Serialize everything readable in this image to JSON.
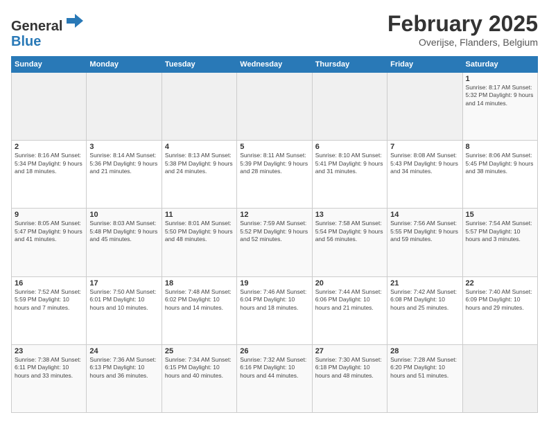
{
  "header": {
    "logo_general": "General",
    "logo_blue": "Blue",
    "month": "February 2025",
    "location": "Overijse, Flanders, Belgium"
  },
  "days_of_week": [
    "Sunday",
    "Monday",
    "Tuesday",
    "Wednesday",
    "Thursday",
    "Friday",
    "Saturday"
  ],
  "weeks": [
    [
      {
        "day": "",
        "info": ""
      },
      {
        "day": "",
        "info": ""
      },
      {
        "day": "",
        "info": ""
      },
      {
        "day": "",
        "info": ""
      },
      {
        "day": "",
        "info": ""
      },
      {
        "day": "",
        "info": ""
      },
      {
        "day": "1",
        "info": "Sunrise: 8:17 AM\nSunset: 5:32 PM\nDaylight: 9 hours and 14 minutes."
      }
    ],
    [
      {
        "day": "2",
        "info": "Sunrise: 8:16 AM\nSunset: 5:34 PM\nDaylight: 9 hours and 18 minutes."
      },
      {
        "day": "3",
        "info": "Sunrise: 8:14 AM\nSunset: 5:36 PM\nDaylight: 9 hours and 21 minutes."
      },
      {
        "day": "4",
        "info": "Sunrise: 8:13 AM\nSunset: 5:38 PM\nDaylight: 9 hours and 24 minutes."
      },
      {
        "day": "5",
        "info": "Sunrise: 8:11 AM\nSunset: 5:39 PM\nDaylight: 9 hours and 28 minutes."
      },
      {
        "day": "6",
        "info": "Sunrise: 8:10 AM\nSunset: 5:41 PM\nDaylight: 9 hours and 31 minutes."
      },
      {
        "day": "7",
        "info": "Sunrise: 8:08 AM\nSunset: 5:43 PM\nDaylight: 9 hours and 34 minutes."
      },
      {
        "day": "8",
        "info": "Sunrise: 8:06 AM\nSunset: 5:45 PM\nDaylight: 9 hours and 38 minutes."
      }
    ],
    [
      {
        "day": "9",
        "info": "Sunrise: 8:05 AM\nSunset: 5:47 PM\nDaylight: 9 hours and 41 minutes."
      },
      {
        "day": "10",
        "info": "Sunrise: 8:03 AM\nSunset: 5:48 PM\nDaylight: 9 hours and 45 minutes."
      },
      {
        "day": "11",
        "info": "Sunrise: 8:01 AM\nSunset: 5:50 PM\nDaylight: 9 hours and 48 minutes."
      },
      {
        "day": "12",
        "info": "Sunrise: 7:59 AM\nSunset: 5:52 PM\nDaylight: 9 hours and 52 minutes."
      },
      {
        "day": "13",
        "info": "Sunrise: 7:58 AM\nSunset: 5:54 PM\nDaylight: 9 hours and 56 minutes."
      },
      {
        "day": "14",
        "info": "Sunrise: 7:56 AM\nSunset: 5:55 PM\nDaylight: 9 hours and 59 minutes."
      },
      {
        "day": "15",
        "info": "Sunrise: 7:54 AM\nSunset: 5:57 PM\nDaylight: 10 hours and 3 minutes."
      }
    ],
    [
      {
        "day": "16",
        "info": "Sunrise: 7:52 AM\nSunset: 5:59 PM\nDaylight: 10 hours and 7 minutes."
      },
      {
        "day": "17",
        "info": "Sunrise: 7:50 AM\nSunset: 6:01 PM\nDaylight: 10 hours and 10 minutes."
      },
      {
        "day": "18",
        "info": "Sunrise: 7:48 AM\nSunset: 6:02 PM\nDaylight: 10 hours and 14 minutes."
      },
      {
        "day": "19",
        "info": "Sunrise: 7:46 AM\nSunset: 6:04 PM\nDaylight: 10 hours and 18 minutes."
      },
      {
        "day": "20",
        "info": "Sunrise: 7:44 AM\nSunset: 6:06 PM\nDaylight: 10 hours and 21 minutes."
      },
      {
        "day": "21",
        "info": "Sunrise: 7:42 AM\nSunset: 6:08 PM\nDaylight: 10 hours and 25 minutes."
      },
      {
        "day": "22",
        "info": "Sunrise: 7:40 AM\nSunset: 6:09 PM\nDaylight: 10 hours and 29 minutes."
      }
    ],
    [
      {
        "day": "23",
        "info": "Sunrise: 7:38 AM\nSunset: 6:11 PM\nDaylight: 10 hours and 33 minutes."
      },
      {
        "day": "24",
        "info": "Sunrise: 7:36 AM\nSunset: 6:13 PM\nDaylight: 10 hours and 36 minutes."
      },
      {
        "day": "25",
        "info": "Sunrise: 7:34 AM\nSunset: 6:15 PM\nDaylight: 10 hours and 40 minutes."
      },
      {
        "day": "26",
        "info": "Sunrise: 7:32 AM\nSunset: 6:16 PM\nDaylight: 10 hours and 44 minutes."
      },
      {
        "day": "27",
        "info": "Sunrise: 7:30 AM\nSunset: 6:18 PM\nDaylight: 10 hours and 48 minutes."
      },
      {
        "day": "28",
        "info": "Sunrise: 7:28 AM\nSunset: 6:20 PM\nDaylight: 10 hours and 51 minutes."
      },
      {
        "day": "",
        "info": ""
      }
    ]
  ]
}
